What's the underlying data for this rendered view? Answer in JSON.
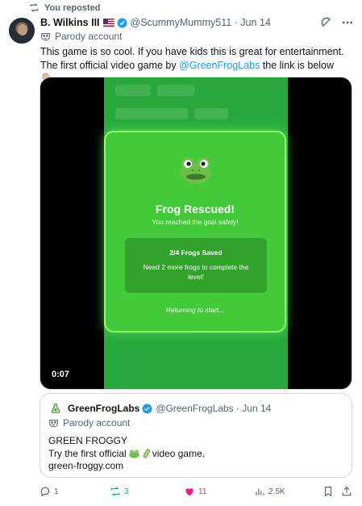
{
  "repost_banner": "You reposted",
  "author": {
    "name": "B. Wilkins III",
    "handle": "@ScummyMummy511",
    "date": "Jun 14",
    "label": "Parody account"
  },
  "tweet": {
    "text_before": "This game is so cool. If you have kids this is great for entertainment. The first official video game by ",
    "mention": "@GreenFrogLabs",
    "text_after": " the link is below 👇🏼"
  },
  "video": {
    "timestamp": "0:07",
    "dialog_title": "Frog Rescued!",
    "dialog_subtitle": "You reached the goal safely!",
    "score_title": "2/4 Frogs Saved",
    "score_desc": "Need 2 more frogs to complete the level!",
    "footer": "Returning to start..."
  },
  "quote": {
    "name": "GreenFrogLabs",
    "handle": "@GreenFrogLabs",
    "date": "Jun 14",
    "label": "Parody account",
    "line1": "GREEN FROGGY",
    "line2_before": "Try the first official",
    "line2_after": "video game.",
    "line3": "green-froggy.com"
  },
  "actions": {
    "replies": "1",
    "reposts": "3",
    "likes": "11",
    "views": "2.5K"
  },
  "colors": {
    "accent": "#1d9bf0",
    "repost_green": "#00ba7c",
    "like_pink": "#f91880",
    "game_green": "#44c93a"
  }
}
